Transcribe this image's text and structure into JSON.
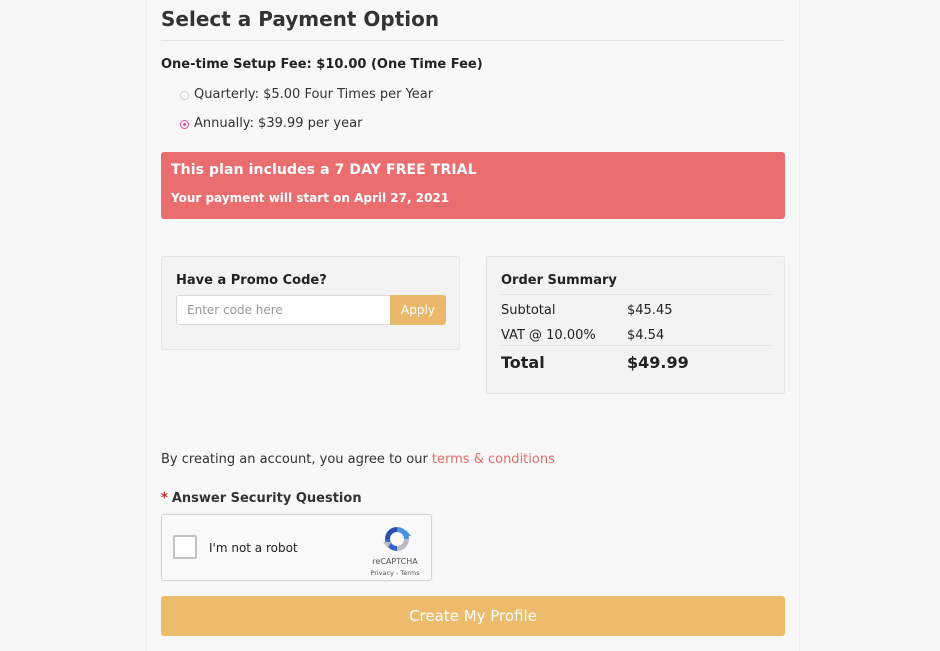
{
  "payment": {
    "title": "Select a Payment Option",
    "setup_fee": "One-time Setup Fee: $10.00 (One Time Fee)",
    "options": [
      {
        "label": "Quarterly: $5.00 Four Times per Year",
        "selected": false
      },
      {
        "label": "Annually: $39.99 per year",
        "selected": true
      }
    ]
  },
  "trial": {
    "title": "This plan includes a 7 DAY FREE TRIAL",
    "subtitle": "Your payment will start on April 27, 2021",
    "color": "#ea6e70"
  },
  "promo": {
    "title": "Have a Promo Code?",
    "placeholder": "Enter code here",
    "apply_label": "Apply"
  },
  "summary": {
    "title": "Order Summary",
    "subtotal_label": "Subtotal",
    "subtotal_value": "$45.45",
    "vat_label": "VAT @ 10.00%",
    "vat_value": "$4.54",
    "total_label": "Total",
    "total_value": "$49.99"
  },
  "terms": {
    "text": "By creating an account, you agree to our ",
    "link": "terms & conditions"
  },
  "security": {
    "asterisk": "*",
    "label": "Answer Security Question"
  },
  "captcha": {
    "label": "I'm not a robot",
    "brand": "reCAPTCHA",
    "links": "Privacy - Terms",
    "icon": "recaptcha-logo"
  },
  "submit": {
    "label": "Create My Profile",
    "color": "#ecbc6c"
  }
}
